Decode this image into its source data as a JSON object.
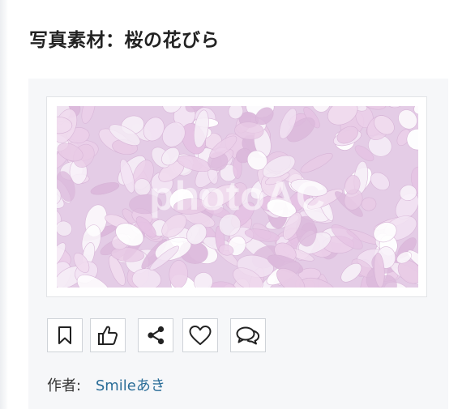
{
  "heading": {
    "title": "写真素材：桜の花びら"
  },
  "photo": {
    "watermark_text": "photoAC"
  },
  "actions": {
    "buttons": [
      {
        "icon": "bookmark-icon"
      },
      {
        "icon": "thumbs-up-icon"
      },
      {
        "icon": "share-icon"
      },
      {
        "icon": "heart-icon"
      },
      {
        "icon": "comment-icon"
      }
    ]
  },
  "author": {
    "label": "作者:",
    "name": "Smileあき"
  },
  "colors": {
    "card_background": "#f6f7f9",
    "link": "#2a6d98",
    "petal_pink": "#e9c6e3"
  }
}
